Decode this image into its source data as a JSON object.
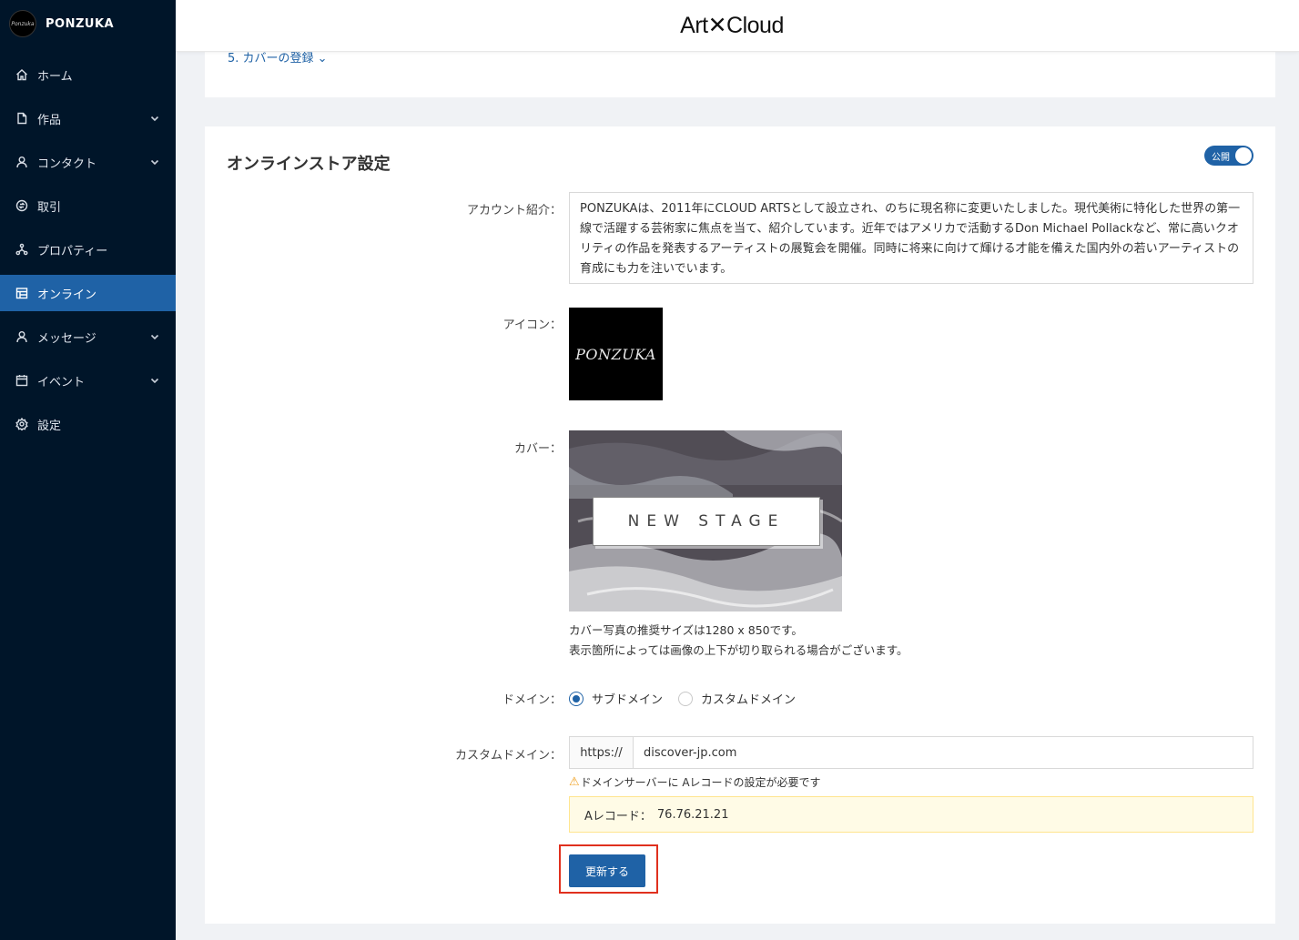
{
  "brand": {
    "name": "PONZUKA"
  },
  "sidebar": {
    "items": [
      {
        "label": "ホーム",
        "icon": "home-icon",
        "has_children": false
      },
      {
        "label": "作品",
        "icon": "file-icon",
        "has_children": true
      },
      {
        "label": "コンタクト",
        "icon": "user-icon",
        "has_children": true
      },
      {
        "label": "取引",
        "icon": "transaction-icon",
        "has_children": false
      },
      {
        "label": "プロパティー",
        "icon": "cluster-icon",
        "has_children": false
      },
      {
        "label": "オンライン",
        "icon": "store-icon",
        "has_children": false,
        "active": true
      },
      {
        "label": "メッセージ",
        "icon": "user-icon",
        "has_children": true
      },
      {
        "label": "イベント",
        "icon": "calendar-icon",
        "has_children": true
      },
      {
        "label": "設定",
        "icon": "gear-icon",
        "has_children": false
      }
    ]
  },
  "header": {
    "logo": "Art✕Cloud"
  },
  "top_card": {
    "link": "5. カバーの登録 ⌄"
  },
  "store": {
    "title": "オンラインストア設定",
    "toggle_label": "公開",
    "account_label": "アカウント紹介：",
    "account_text": "PONZUKAは、2011年にCLOUD ARTSとして設立され、のちに現名称に変更いたしました。現代美術に特化した世界の第一線で活躍する芸術家に焦点を当て、紹介しています。近年ではアメリカで活動するDon Michael Pollackなど、常に高いクオリティの作品を発表するアーティストの展覧会を開催。同時に将来に向けて輝ける才能を備えた国内外の若いアーティストの育成にも力を注いでいます。",
    "icon_label": "アイコン：",
    "icon_text": "PONZUKA",
    "cover_label": "カバー：",
    "cover_text": "NEW STAGE",
    "cover_note_1": "カバー写真の推奨サイズは1280 x 850です。",
    "cover_note_2": "表示箇所によっては画像の上下が切り取られる場合がございます。",
    "domain_label": "ドメイン：",
    "domain_options": [
      "サブドメイン",
      "カスタムドメイン"
    ],
    "domain_selected": "サブドメイン",
    "custom_domain_label": "カスタムドメイン：",
    "custom_domain_prefix": "https://",
    "custom_domain_value": "discover-jp.com",
    "warning": "ドメインサーバーに Aレコードの設定が必要です",
    "arecord_label": "Aレコード：",
    "arecord_value": "76.76.21.21",
    "submit_label": "更新する"
  },
  "colors": {
    "sidebar_bg": "#001529",
    "accent": "#1f62a6",
    "highlight": "#e0301e"
  }
}
